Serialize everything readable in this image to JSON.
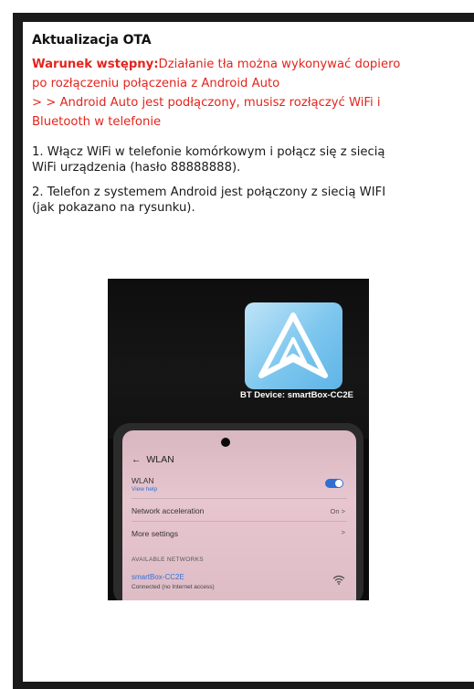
{
  "title": "Aktualizacja OTA",
  "precondition": {
    "label": "Warunek wstępny:",
    "line1": "Działanie tła można wykonywać dopiero",
    "line2": "po rozłączeniu połączenia z Android Auto",
    "line3": "> > Android Auto jest podłączony, musisz rozłączyć WiFi i",
    "line4": "Bluetooth w telefonie"
  },
  "steps": [
    {
      "line1": "1. Włącz WiFi w telefonie komórkowym i połącz się z siecią",
      "line2": "WiFi urządzenia (hasło 88888888)."
    },
    {
      "line1": "2. Telefon z systemem Android jest połączony z siecią WIFI",
      "line2": "(jak pokazano na rysunku)."
    }
  ],
  "photo": {
    "device_label": "BT Device: smartBox-CC2E",
    "phone": {
      "header": "WLAN",
      "wlan_label": "WLAN",
      "view_help": "View help",
      "network_acceleration": "Network acceleration",
      "network_acceleration_value": "On",
      "more_settings": "More settings",
      "available_networks": "AVAILABLE NETWORKS",
      "network_name": "smartBox-CC2E",
      "network_status": "Connected (no Internet access)"
    }
  },
  "colors": {
    "warning_red": "#e3251d",
    "text": "#1a1a1a",
    "android_auto_tile": "#7cc6ee",
    "phone_accent": "#2f6fd0"
  }
}
